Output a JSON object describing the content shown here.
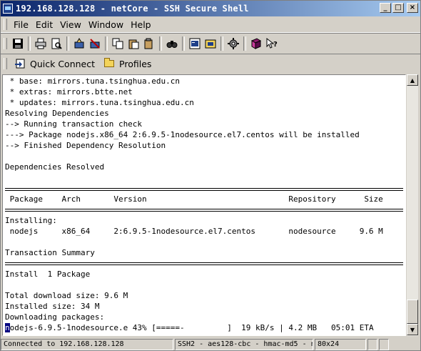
{
  "window": {
    "title": "192.168.128.128 - netCore - SSH Secure Shell",
    "buttons": {
      "minimize": "_",
      "maximize": "□",
      "close": "×"
    }
  },
  "menubar": [
    "File",
    "Edit",
    "View",
    "Window",
    "Help"
  ],
  "toolbar": {
    "icons": [
      "save-icon",
      "print-icon",
      "print-preview-icon",
      "connect-icon",
      "disconnect-icon",
      "copy-icon",
      "paste-icon",
      "paste-special-icon",
      "find-icon",
      "new-terminal-icon",
      "new-file-transfer-icon",
      "settings-icon",
      "help-book-icon",
      "context-help-icon"
    ]
  },
  "quickbar": {
    "quick_connect": "Quick Connect",
    "profiles": "Profiles"
  },
  "terminal": {
    "lines": [
      " * base: mirrors.tuna.tsinghua.edu.cn",
      " * extras: mirrors.btte.net",
      " * updates: mirrors.tuna.tsinghua.edu.cn",
      "Resolving Dependencies",
      "--> Running transaction check",
      "---> Package nodejs.x86_64 2:6.9.5-1nodesource.el7.centos will be installed",
      "--> Finished Dependency Resolution",
      "",
      "Dependencies Resolved",
      "",
      "",
      " Package    Arch       Version                              Repository      Size",
      "",
      "Installing:",
      " nodejs     x86_64     2:6.9.5-1nodesource.el7.centos       nodesource     9.6 M",
      "",
      "Transaction Summary",
      "",
      "Install  1 Package",
      "",
      "Total download size: 9.6 M",
      "Installed size: 34 M",
      "Downloading packages:",
      "odejs-6.9.5-1nodesource.e 43% [=====-         ]  19 kB/s | 4.2 MB   05:01 ETA"
    ],
    "cursor_char": "n"
  },
  "statusbar": {
    "connection": "Connected to 192.168.128.128",
    "cipher": "SSH2 - aes128-cbc - hmac-md5 - n",
    "size": "80x24"
  }
}
